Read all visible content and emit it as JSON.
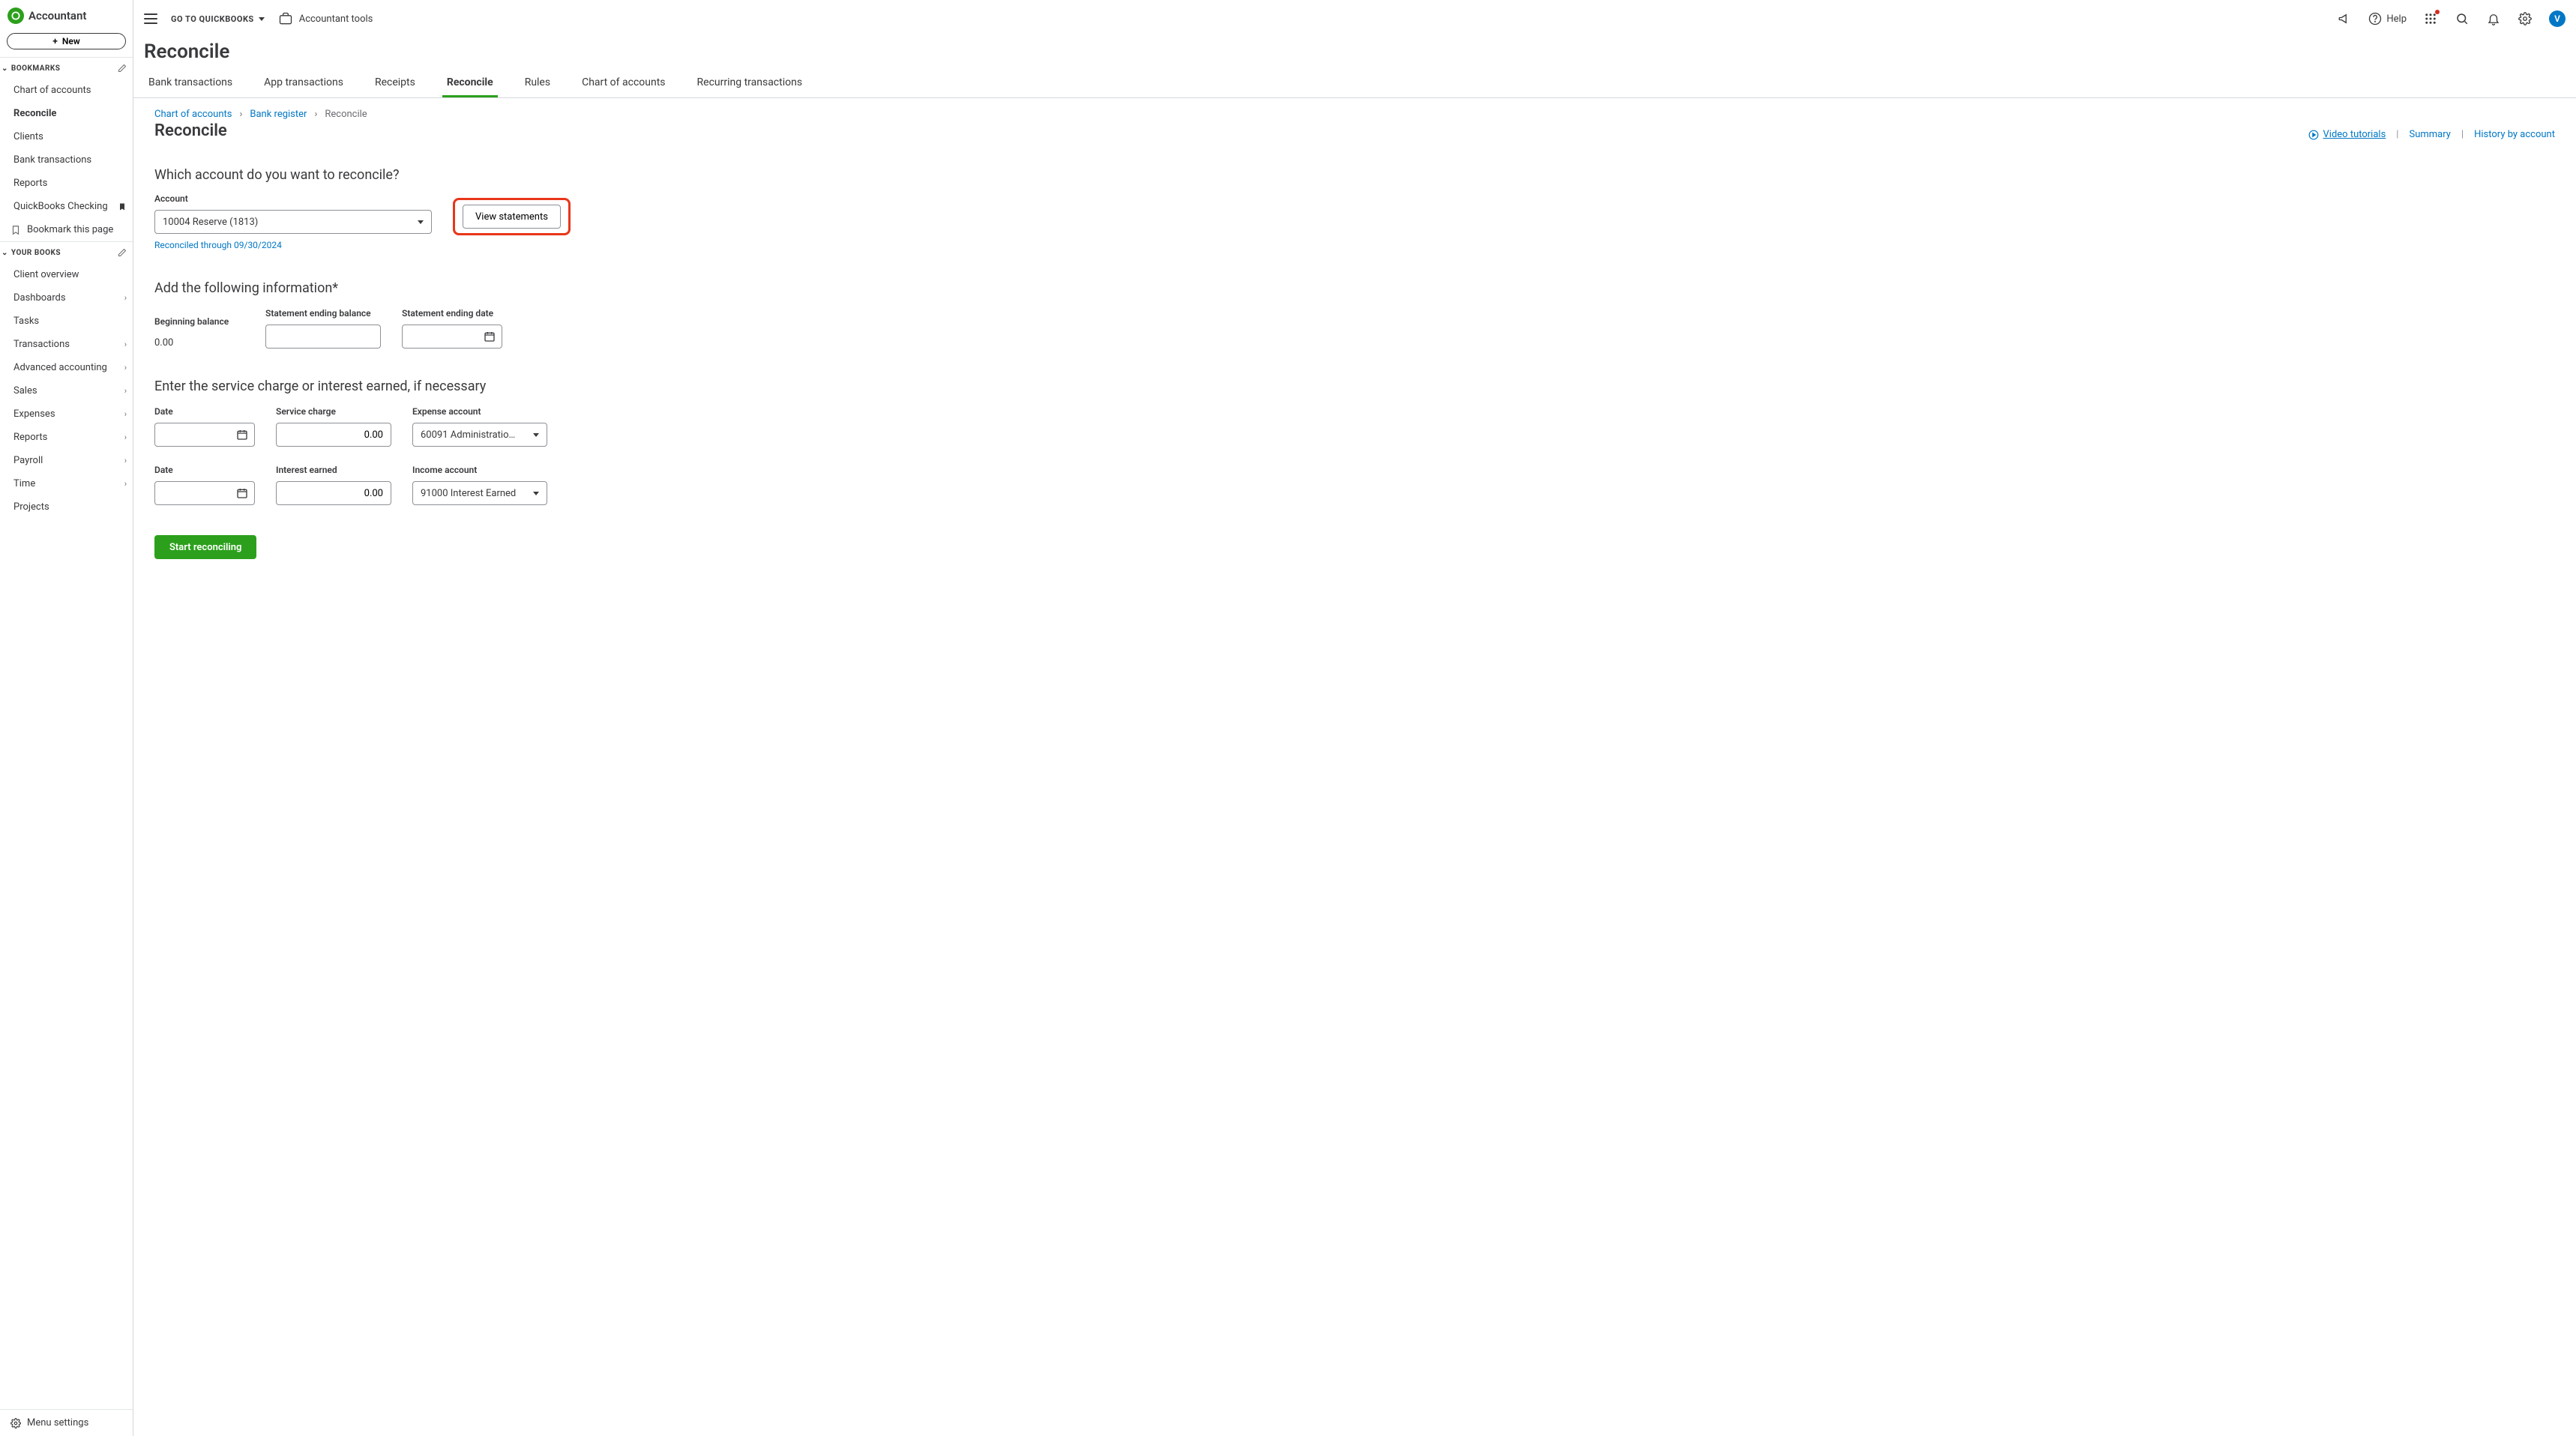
{
  "brand": "Accountant",
  "new_button": "New",
  "sidebar": {
    "section_bookmarks": "BOOKMARKS",
    "bookmarks": [
      "Chart of accounts",
      "Reconcile",
      "Clients",
      "Bank transactions",
      "Reports",
      "QuickBooks Checking"
    ],
    "bookmark_this_page": "Bookmark this page",
    "section_your_books": "YOUR BOOKS",
    "your_books": [
      {
        "label": "Client overview",
        "has_chev": false
      },
      {
        "label": "Dashboards",
        "has_chev": true
      },
      {
        "label": "Tasks",
        "has_chev": false
      },
      {
        "label": "Transactions",
        "has_chev": true
      },
      {
        "label": "Advanced accounting",
        "has_chev": true
      },
      {
        "label": "Sales",
        "has_chev": true
      },
      {
        "label": "Expenses",
        "has_chev": true
      },
      {
        "label": "Reports",
        "has_chev": true
      },
      {
        "label": "Payroll",
        "has_chev": true
      },
      {
        "label": "Time",
        "has_chev": true
      },
      {
        "label": "Projects",
        "has_chev": false
      }
    ],
    "menu_settings": "Menu settings"
  },
  "topbar": {
    "go_to_qb": "GO TO QUICKBOOKS",
    "acct_tools": "Accountant tools",
    "help": "Help",
    "avatar_letter": "V"
  },
  "page_heading": "Reconcile",
  "tabs": [
    "Bank transactions",
    "App transactions",
    "Receipts",
    "Reconcile",
    "Rules",
    "Chart of accounts",
    "Recurring transactions"
  ],
  "active_tab": 3,
  "breadcrumb": {
    "a": "Chart of accounts",
    "b": "Bank register",
    "c": "Reconcile"
  },
  "content_title": "Reconcile",
  "header_links": {
    "video": "Video tutorials",
    "summary": "Summary",
    "history": "History by account"
  },
  "form": {
    "which_q": "Which account do you want to reconcile?",
    "account_label": "Account",
    "account_value": "10004 Reserve (1813)",
    "view_statements": "View statements",
    "reconciled_through": "Reconciled through 09/30/2024",
    "add_info_heading": "Add the following information*",
    "beg_balance_label": "Beginning balance",
    "beg_balance_value": "0.00",
    "stmt_end_bal_label": "Statement ending balance",
    "stmt_end_date_label": "Statement ending date",
    "service_heading": "Enter the service charge or interest earned, if necessary",
    "date_label": "Date",
    "service_charge_label": "Service charge",
    "service_charge_value": "0.00",
    "expense_acct_label": "Expense account",
    "expense_acct_value": "60091 Administratio…",
    "interest_earned_label": "Interest earned",
    "interest_earned_value": "0.00",
    "income_acct_label": "Income account",
    "income_acct_value": "91000 Interest Earned",
    "start_button": "Start reconciling"
  }
}
